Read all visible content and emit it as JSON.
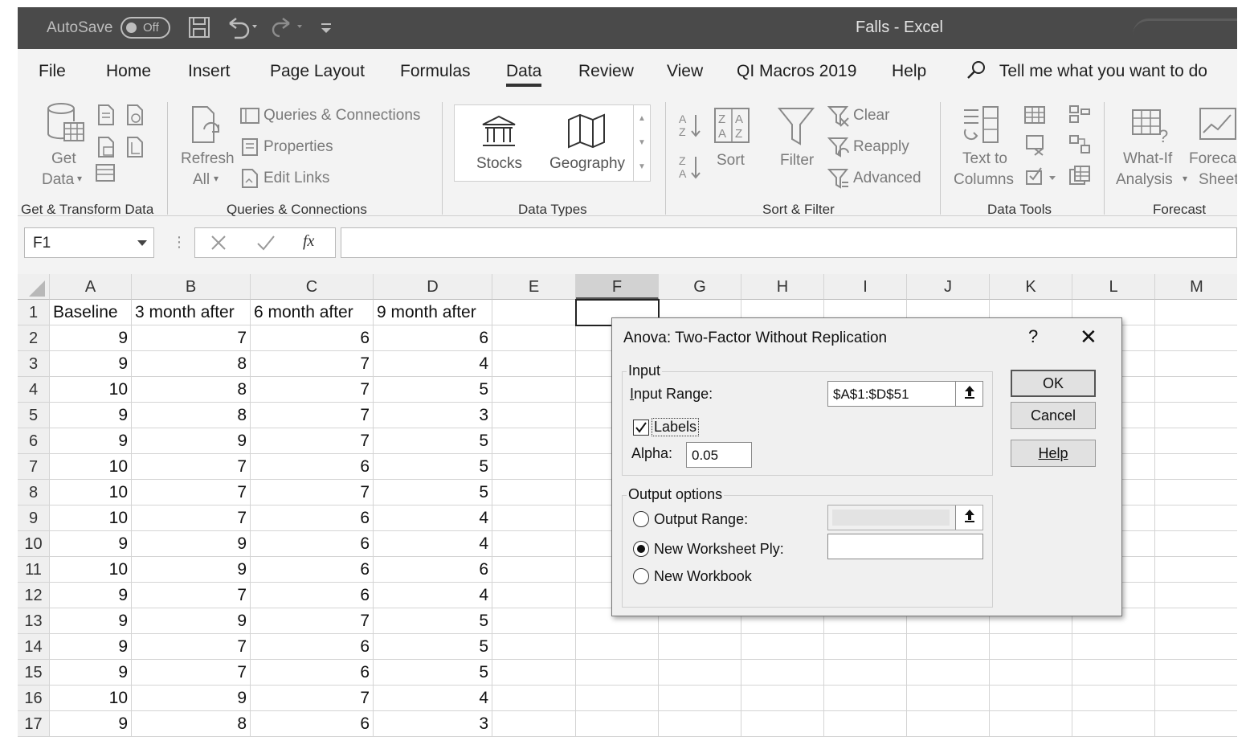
{
  "titlebar": {
    "autosave_label": "AutoSave",
    "toggle_state": "Off",
    "window_title": "Falls  -  Excel"
  },
  "menu": {
    "tabs": [
      "File",
      "Home",
      "Insert",
      "Page Layout",
      "Formulas",
      "Data",
      "Review",
      "View",
      "QI Macros 2019",
      "Help"
    ],
    "active_tab": "Data",
    "tell_me": "Tell me what you want to do"
  },
  "ribbon": {
    "get_data": [
      "Get",
      "Data"
    ],
    "refresh_all": [
      "Refresh",
      "All"
    ],
    "queries_connections": "Queries & Connections",
    "properties": "Properties",
    "edit_links": "Edit Links",
    "stocks": "Stocks",
    "geography": "Geography",
    "sort": "Sort",
    "filter": "Filter",
    "clear": "Clear",
    "reapply": "Reapply",
    "advanced": "Advanced",
    "text_to_columns": [
      "Text to",
      "Columns"
    ],
    "what_if": [
      "What-If",
      "Analysis"
    ],
    "forecast_sheet": [
      "Forecast",
      "Sheet"
    ],
    "groups": [
      "Get & Transform Data",
      "Queries & Connections",
      "Data Types",
      "Sort & Filter",
      "Data Tools",
      "Forecast"
    ]
  },
  "formula_bar": {
    "name_box": "F1",
    "fx": "fx",
    "formula": ""
  },
  "sheet": {
    "columns": [
      "A",
      "B",
      "C",
      "D",
      "E",
      "F",
      "G",
      "H",
      "I",
      "J",
      "K",
      "L",
      "M"
    ],
    "selected_column": "F",
    "header_row": [
      "Baseline",
      "3 month after",
      "6 month after",
      "9 month after"
    ],
    "rows": [
      {
        "n": "1",
        "cells": []
      },
      {
        "n": "2",
        "cells": [
          "9",
          "7",
          "6",
          "6"
        ]
      },
      {
        "n": "3",
        "cells": [
          "9",
          "8",
          "7",
          "4"
        ]
      },
      {
        "n": "4",
        "cells": [
          "10",
          "8",
          "7",
          "5"
        ]
      },
      {
        "n": "5",
        "cells": [
          "9",
          "8",
          "7",
          "3"
        ]
      },
      {
        "n": "6",
        "cells": [
          "9",
          "9",
          "7",
          "5"
        ]
      },
      {
        "n": "7",
        "cells": [
          "10",
          "7",
          "6",
          "5"
        ]
      },
      {
        "n": "8",
        "cells": [
          "10",
          "7",
          "7",
          "5"
        ]
      },
      {
        "n": "9",
        "cells": [
          "10",
          "7",
          "6",
          "4"
        ]
      },
      {
        "n": "10",
        "cells": [
          "9",
          "9",
          "6",
          "4"
        ]
      },
      {
        "n": "11",
        "cells": [
          "10",
          "9",
          "6",
          "6"
        ]
      },
      {
        "n": "12",
        "cells": [
          "9",
          "7",
          "6",
          "4"
        ]
      },
      {
        "n": "13",
        "cells": [
          "9",
          "9",
          "7",
          "5"
        ]
      },
      {
        "n": "14",
        "cells": [
          "9",
          "7",
          "6",
          "5"
        ]
      },
      {
        "n": "15",
        "cells": [
          "9",
          "7",
          "6",
          "5"
        ]
      },
      {
        "n": "16",
        "cells": [
          "10",
          "9",
          "7",
          "4"
        ]
      },
      {
        "n": "17",
        "cells": [
          "9",
          "8",
          "6",
          "3"
        ]
      }
    ]
  },
  "dialog": {
    "title": "Anova: Two-Factor Without Replication",
    "help_glyph": "?",
    "close_glyph": "✕",
    "input_legend": "Input",
    "input_range_label": "Input Range:",
    "input_range_value": "$A$1:$D$51",
    "labels_label": "Labels",
    "labels_checked": true,
    "alpha_label": "Alpha:",
    "alpha_value": "0.05",
    "output_legend": "Output options",
    "output_range_label": "Output Range:",
    "new_ply_label": "New Worksheet Ply:",
    "new_workbook_label": "New Workbook",
    "selected_output": "New Worksheet Ply",
    "ok": "OK",
    "cancel": "Cancel",
    "help": "Help"
  }
}
